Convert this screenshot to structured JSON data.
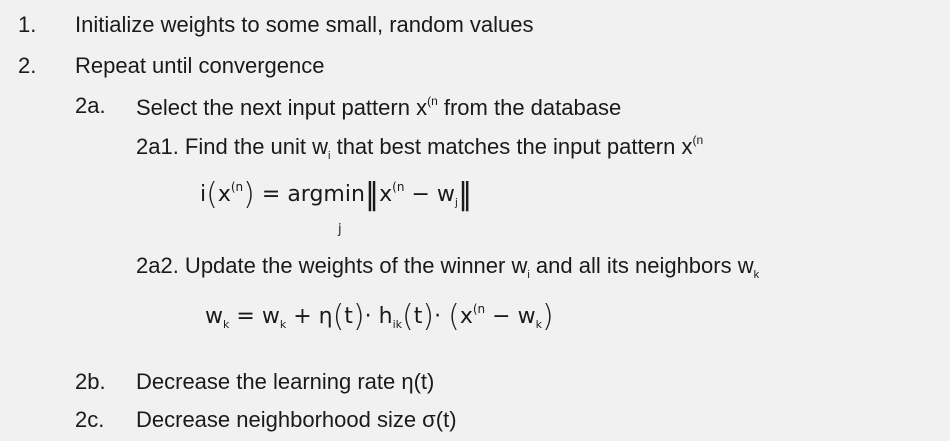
{
  "steps": [
    {
      "num": "1.",
      "text": "Initialize weights to some small, random values"
    },
    {
      "num": "2.",
      "text": "Repeat until convergence"
    }
  ],
  "step_2a": {
    "num": "2a.",
    "text_before": "Select the next input pattern x",
    "sup": "(n",
    "text_after": " from the database"
  },
  "step_2a1": {
    "text_before": "2a1. Find the unit w",
    "sub": "i",
    "text_mid": " that best matches the input pattern x",
    "sup": "(n"
  },
  "formula1": {
    "i": "i",
    "x": "x",
    "sup": "(n",
    "eq": "=",
    "argmin": "argmin",
    "under": "j",
    "x2": "x",
    "sup2": "(n",
    "minus": "−",
    "w": "w",
    "wsub": "j"
  },
  "step_2a2": {
    "text_before": "2a2. Update the weights of the winner w",
    "sub": "i",
    "text_mid": " and all its neighbors w",
    "sub2": "k"
  },
  "formula2": {
    "w1": "w",
    "k1": "k",
    "eq": "=",
    "w2": "w",
    "k2": "k",
    "plus": "+",
    "eta": "η",
    "t1": "t",
    "dot": "·",
    "h": "h",
    "ik": "ik",
    "t2": "t",
    "dot2": "·",
    "x": "x",
    "sup": "(n",
    "minus": "−",
    "w3": "w",
    "k3": "k"
  },
  "step_2b": {
    "num": "2b.",
    "text": "Decrease the learning rate η(t)"
  },
  "step_2c": {
    "num": "2c.",
    "text": "Decrease neighborhood size σ(t)"
  }
}
